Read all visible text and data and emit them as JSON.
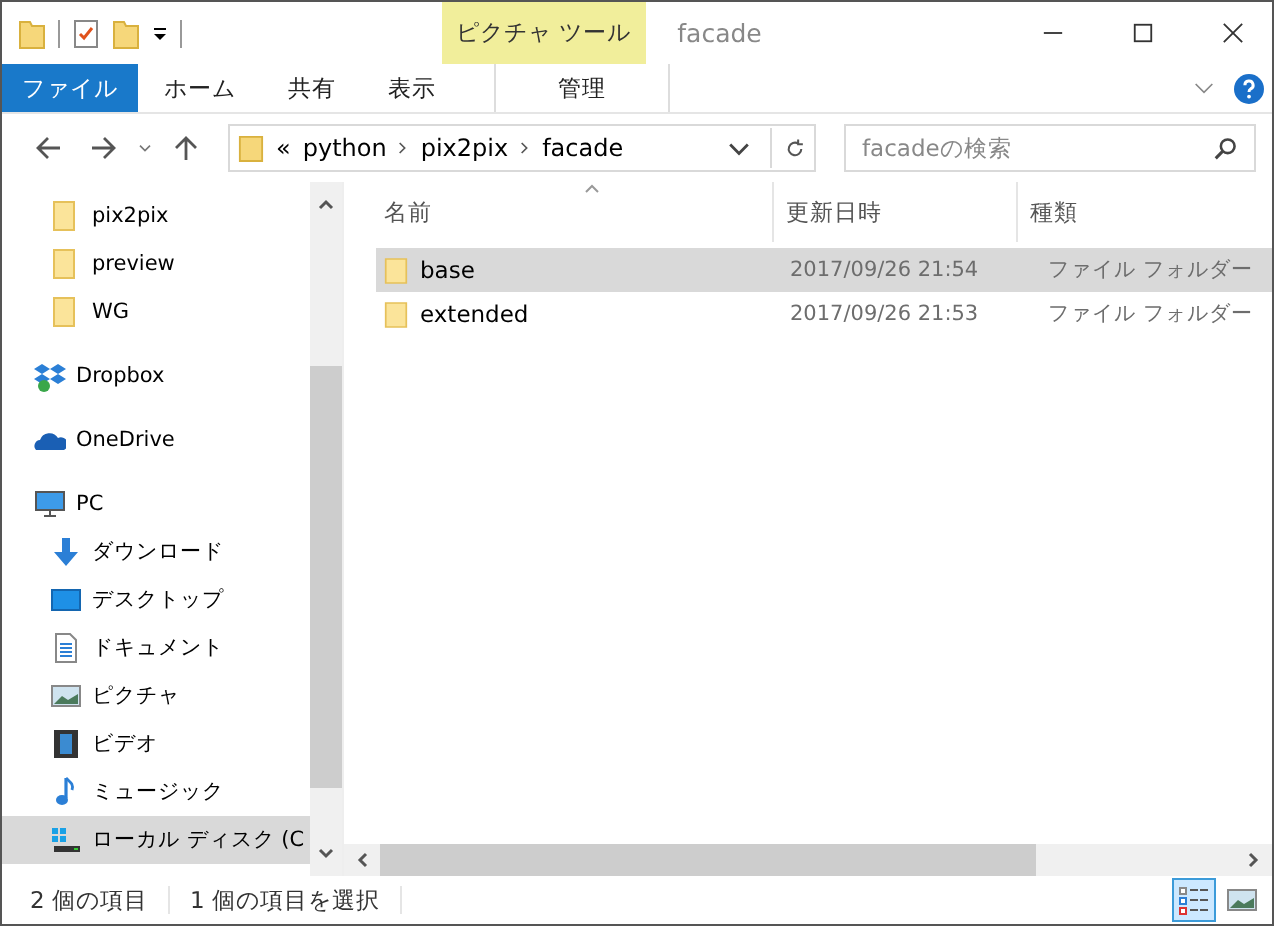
{
  "window": {
    "title": "facade",
    "context_tab": "ピクチャ ツール"
  },
  "ribbon_tabs": [
    {
      "label": "ファイル",
      "kind": "file",
      "selected": false
    },
    {
      "label": "ホーム",
      "kind": "tab",
      "selected": false
    },
    {
      "label": "共有",
      "kind": "tab",
      "selected": false
    },
    {
      "label": "表示",
      "kind": "tab",
      "selected": false
    },
    {
      "label": "管理",
      "kind": "context",
      "selected": false
    }
  ],
  "address": {
    "overflow": "«",
    "crumbs": [
      "python",
      "pix2pix",
      "facade"
    ]
  },
  "search": {
    "placeholder": "facadeの検索"
  },
  "sidebar": {
    "items": [
      {
        "label": "pix2pix",
        "kind": "folder",
        "indent": true,
        "selected": false
      },
      {
        "label": "preview",
        "kind": "folder",
        "indent": true,
        "selected": false
      },
      {
        "label": "WG",
        "kind": "folder",
        "indent": true,
        "selected": false
      },
      {
        "label": "Dropbox",
        "kind": "dropbox",
        "indent": false,
        "selected": false
      },
      {
        "label": "OneDrive",
        "kind": "onedrive",
        "indent": false,
        "selected": false
      },
      {
        "label": "PC",
        "kind": "pc",
        "indent": false,
        "selected": false
      },
      {
        "label": "ダウンロード",
        "kind": "download",
        "indent": true,
        "selected": false
      },
      {
        "label": "デスクトップ",
        "kind": "desktop",
        "indent": true,
        "selected": false
      },
      {
        "label": "ドキュメント",
        "kind": "document",
        "indent": true,
        "selected": false
      },
      {
        "label": "ピクチャ",
        "kind": "picture",
        "indent": true,
        "selected": false
      },
      {
        "label": "ビデオ",
        "kind": "video",
        "indent": true,
        "selected": false
      },
      {
        "label": "ミュージック",
        "kind": "music",
        "indent": true,
        "selected": false
      },
      {
        "label": "ローカル ディスク (C",
        "kind": "disk",
        "indent": true,
        "selected": true
      }
    ]
  },
  "table": {
    "columns": [
      "名前",
      "更新日時",
      "種類"
    ],
    "rows": [
      {
        "name": "base",
        "date": "2017/09/26 21:54",
        "type": "ファイル フォルダー",
        "selected": true
      },
      {
        "name": "extended",
        "date": "2017/09/26 21:53",
        "type": "ファイル フォルダー",
        "selected": false
      }
    ]
  },
  "status_bar": {
    "count": "2 個の項目",
    "selection": "1 個の項目を選択",
    "view_buttons": [
      {
        "kind": "details",
        "selected": true
      },
      {
        "kind": "icons",
        "selected": false
      }
    ]
  }
}
